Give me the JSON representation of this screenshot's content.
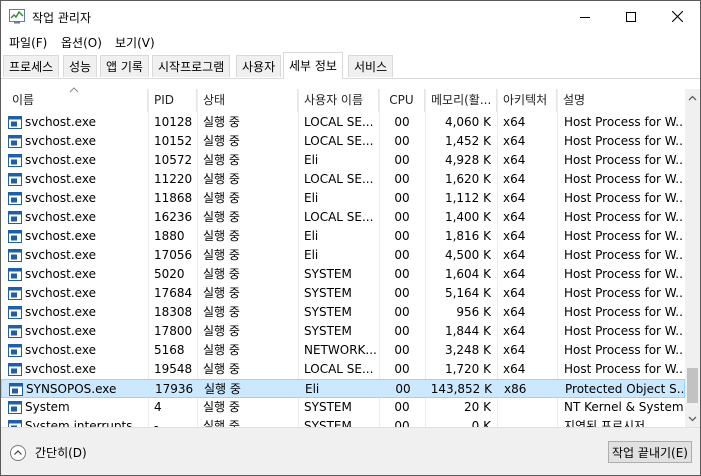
{
  "window": {
    "title": "작업 관리자"
  },
  "menu": [
    "파일(F)",
    "옵션(O)",
    "보기(V)"
  ],
  "tabs": [
    {
      "label": "프로세스",
      "active": false
    },
    {
      "label": "성능",
      "active": false
    },
    {
      "label": "앱 기록",
      "active": false
    },
    {
      "label": "시작프로그램",
      "active": false
    },
    {
      "label": "사용자",
      "active": false
    },
    {
      "label": "세부 정보",
      "active": true
    },
    {
      "label": "서비스",
      "active": false
    }
  ],
  "columns": [
    "이름",
    "PID",
    "상태",
    "사용자 이름",
    "CPU",
    "메모리(활...",
    "아키텍처",
    "설명"
  ],
  "rows": [
    {
      "name": "svchost.exe",
      "pid": "10128",
      "status": "실행 중",
      "user": "LOCAL SE...",
      "cpu": "00",
      "mem": "4,060 K",
      "arch": "x64",
      "desc": "Host Process for W..."
    },
    {
      "name": "svchost.exe",
      "pid": "10152",
      "status": "실행 중",
      "user": "LOCAL SE...",
      "cpu": "00",
      "mem": "1,452 K",
      "arch": "x64",
      "desc": "Host Process for W..."
    },
    {
      "name": "svchost.exe",
      "pid": "10572",
      "status": "실행 중",
      "user": "Eli",
      "cpu": "00",
      "mem": "4,928 K",
      "arch": "x64",
      "desc": "Host Process for W..."
    },
    {
      "name": "svchost.exe",
      "pid": "11220",
      "status": "실행 중",
      "user": "LOCAL SE...",
      "cpu": "00",
      "mem": "1,620 K",
      "arch": "x64",
      "desc": "Host Process for W..."
    },
    {
      "name": "svchost.exe",
      "pid": "11868",
      "status": "실행 중",
      "user": "Eli",
      "cpu": "00",
      "mem": "1,112 K",
      "arch": "x64",
      "desc": "Host Process for W..."
    },
    {
      "name": "svchost.exe",
      "pid": "16236",
      "status": "실행 중",
      "user": "LOCAL SE...",
      "cpu": "00",
      "mem": "1,400 K",
      "arch": "x64",
      "desc": "Host Process for W..."
    },
    {
      "name": "svchost.exe",
      "pid": "1880",
      "status": "실행 중",
      "user": "Eli",
      "cpu": "00",
      "mem": "1,816 K",
      "arch": "x64",
      "desc": "Host Process for W..."
    },
    {
      "name": "svchost.exe",
      "pid": "17056",
      "status": "실행 중",
      "user": "Eli",
      "cpu": "00",
      "mem": "4,500 K",
      "arch": "x64",
      "desc": "Host Process for W..."
    },
    {
      "name": "svchost.exe",
      "pid": "5020",
      "status": "실행 중",
      "user": "SYSTEM",
      "cpu": "00",
      "mem": "1,604 K",
      "arch": "x64",
      "desc": "Host Process for W..."
    },
    {
      "name": "svchost.exe",
      "pid": "17684",
      "status": "실행 중",
      "user": "SYSTEM",
      "cpu": "00",
      "mem": "5,164 K",
      "arch": "x64",
      "desc": "Host Process for W..."
    },
    {
      "name": "svchost.exe",
      "pid": "18308",
      "status": "실행 중",
      "user": "SYSTEM",
      "cpu": "00",
      "mem": "956 K",
      "arch": "x64",
      "desc": "Host Process for W..."
    },
    {
      "name": "svchost.exe",
      "pid": "17800",
      "status": "실행 중",
      "user": "SYSTEM",
      "cpu": "00",
      "mem": "1,844 K",
      "arch": "x64",
      "desc": "Host Process for W..."
    },
    {
      "name": "svchost.exe",
      "pid": "5168",
      "status": "실행 중",
      "user": "NETWORK...",
      "cpu": "00",
      "mem": "3,248 K",
      "arch": "x64",
      "desc": "Host Process for W..."
    },
    {
      "name": "svchost.exe",
      "pid": "19548",
      "status": "실행 중",
      "user": "LOCAL SE...",
      "cpu": "00",
      "mem": "1,720 K",
      "arch": "x64",
      "desc": "Host Process for W..."
    },
    {
      "name": "SYNSOPOS.exe",
      "pid": "17936",
      "status": "실행 중",
      "user": "Eli",
      "cpu": "00",
      "mem": "143,852 K",
      "arch": "x86",
      "desc": "Protected Object S...",
      "selected": true
    },
    {
      "name": "System",
      "pid": "4",
      "status": "실행 중",
      "user": "SYSTEM",
      "cpu": "00",
      "mem": "20 K",
      "arch": "",
      "desc": "NT Kernel & System"
    },
    {
      "name": "System interrupts",
      "pid": "-",
      "status": "실행 중",
      "user": "SYSTEM",
      "cpu": "00",
      "mem": "0 K",
      "arch": "",
      "desc": "지연된 프로시저"
    }
  ],
  "footer": {
    "fewer_details": "간단히(D)",
    "end_task": "작업 끝내기(E)"
  },
  "colors": {
    "selection_bg": "#cce8ff",
    "selection_border": "#99d1ff",
    "footer_bg": "#f0f0f0",
    "icon_blue": "#1f5fa8"
  }
}
